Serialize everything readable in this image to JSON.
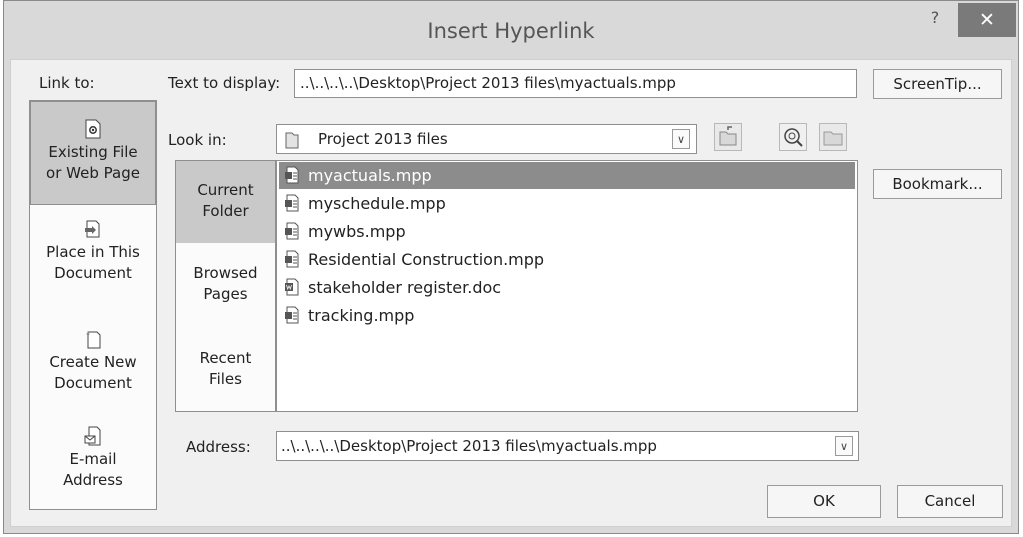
{
  "window": {
    "title": "Insert Hyperlink",
    "help": "?",
    "close": "✕"
  },
  "link_to": {
    "label": "Link to:",
    "items": [
      {
        "line1": "Existing File",
        "line2": "or Web Page",
        "icon": "existing-file-icon",
        "selected": true
      },
      {
        "line1": "Place in This",
        "line2": "Document",
        "icon": "place-in-document-icon",
        "selected": false
      },
      {
        "line1": "Create New",
        "line2": "Document",
        "icon": "new-document-icon",
        "selected": false
      },
      {
        "line1": "E-mail",
        "line2": "Address",
        "icon": "email-icon",
        "selected": false
      }
    ]
  },
  "text_to_display": {
    "label": "Text to display:",
    "value": "..\\..\\..\\..\\Desktop\\Project 2013 files\\myactuals.mpp"
  },
  "screentip_button": "ScreenTip...",
  "look_in": {
    "label": "Look in:",
    "value": "Project 2013 files"
  },
  "bookmark_button": "Bookmark...",
  "nav": [
    {
      "line1": "Current",
      "line2": "Folder",
      "selected": true
    },
    {
      "line1": "Browsed",
      "line2": "Pages",
      "selected": false
    },
    {
      "line1": "Recent",
      "line2": "Files",
      "selected": false
    }
  ],
  "files": [
    {
      "name": "myactuals.mpp",
      "type": "mpp",
      "selected": true
    },
    {
      "name": "myschedule.mpp",
      "type": "mpp",
      "selected": false
    },
    {
      "name": "mywbs.mpp",
      "type": "mpp",
      "selected": false
    },
    {
      "name": "Residential Construction.mpp",
      "type": "mpp",
      "selected": false
    },
    {
      "name": "stakeholder register.doc",
      "type": "doc",
      "selected": false
    },
    {
      "name": "tracking.mpp",
      "type": "mpp",
      "selected": false
    }
  ],
  "address": {
    "label": "Address:",
    "value": "..\\..\\..\\..\\Desktop\\Project 2013 files\\myactuals.mpp"
  },
  "ok_button": "OK",
  "cancel_button": "Cancel",
  "colors": {
    "selected_file": "#8c8c8c",
    "title_text": "#555555",
    "close_button": "#7a7a7a",
    "selected_nav": "#c9c9c9"
  }
}
